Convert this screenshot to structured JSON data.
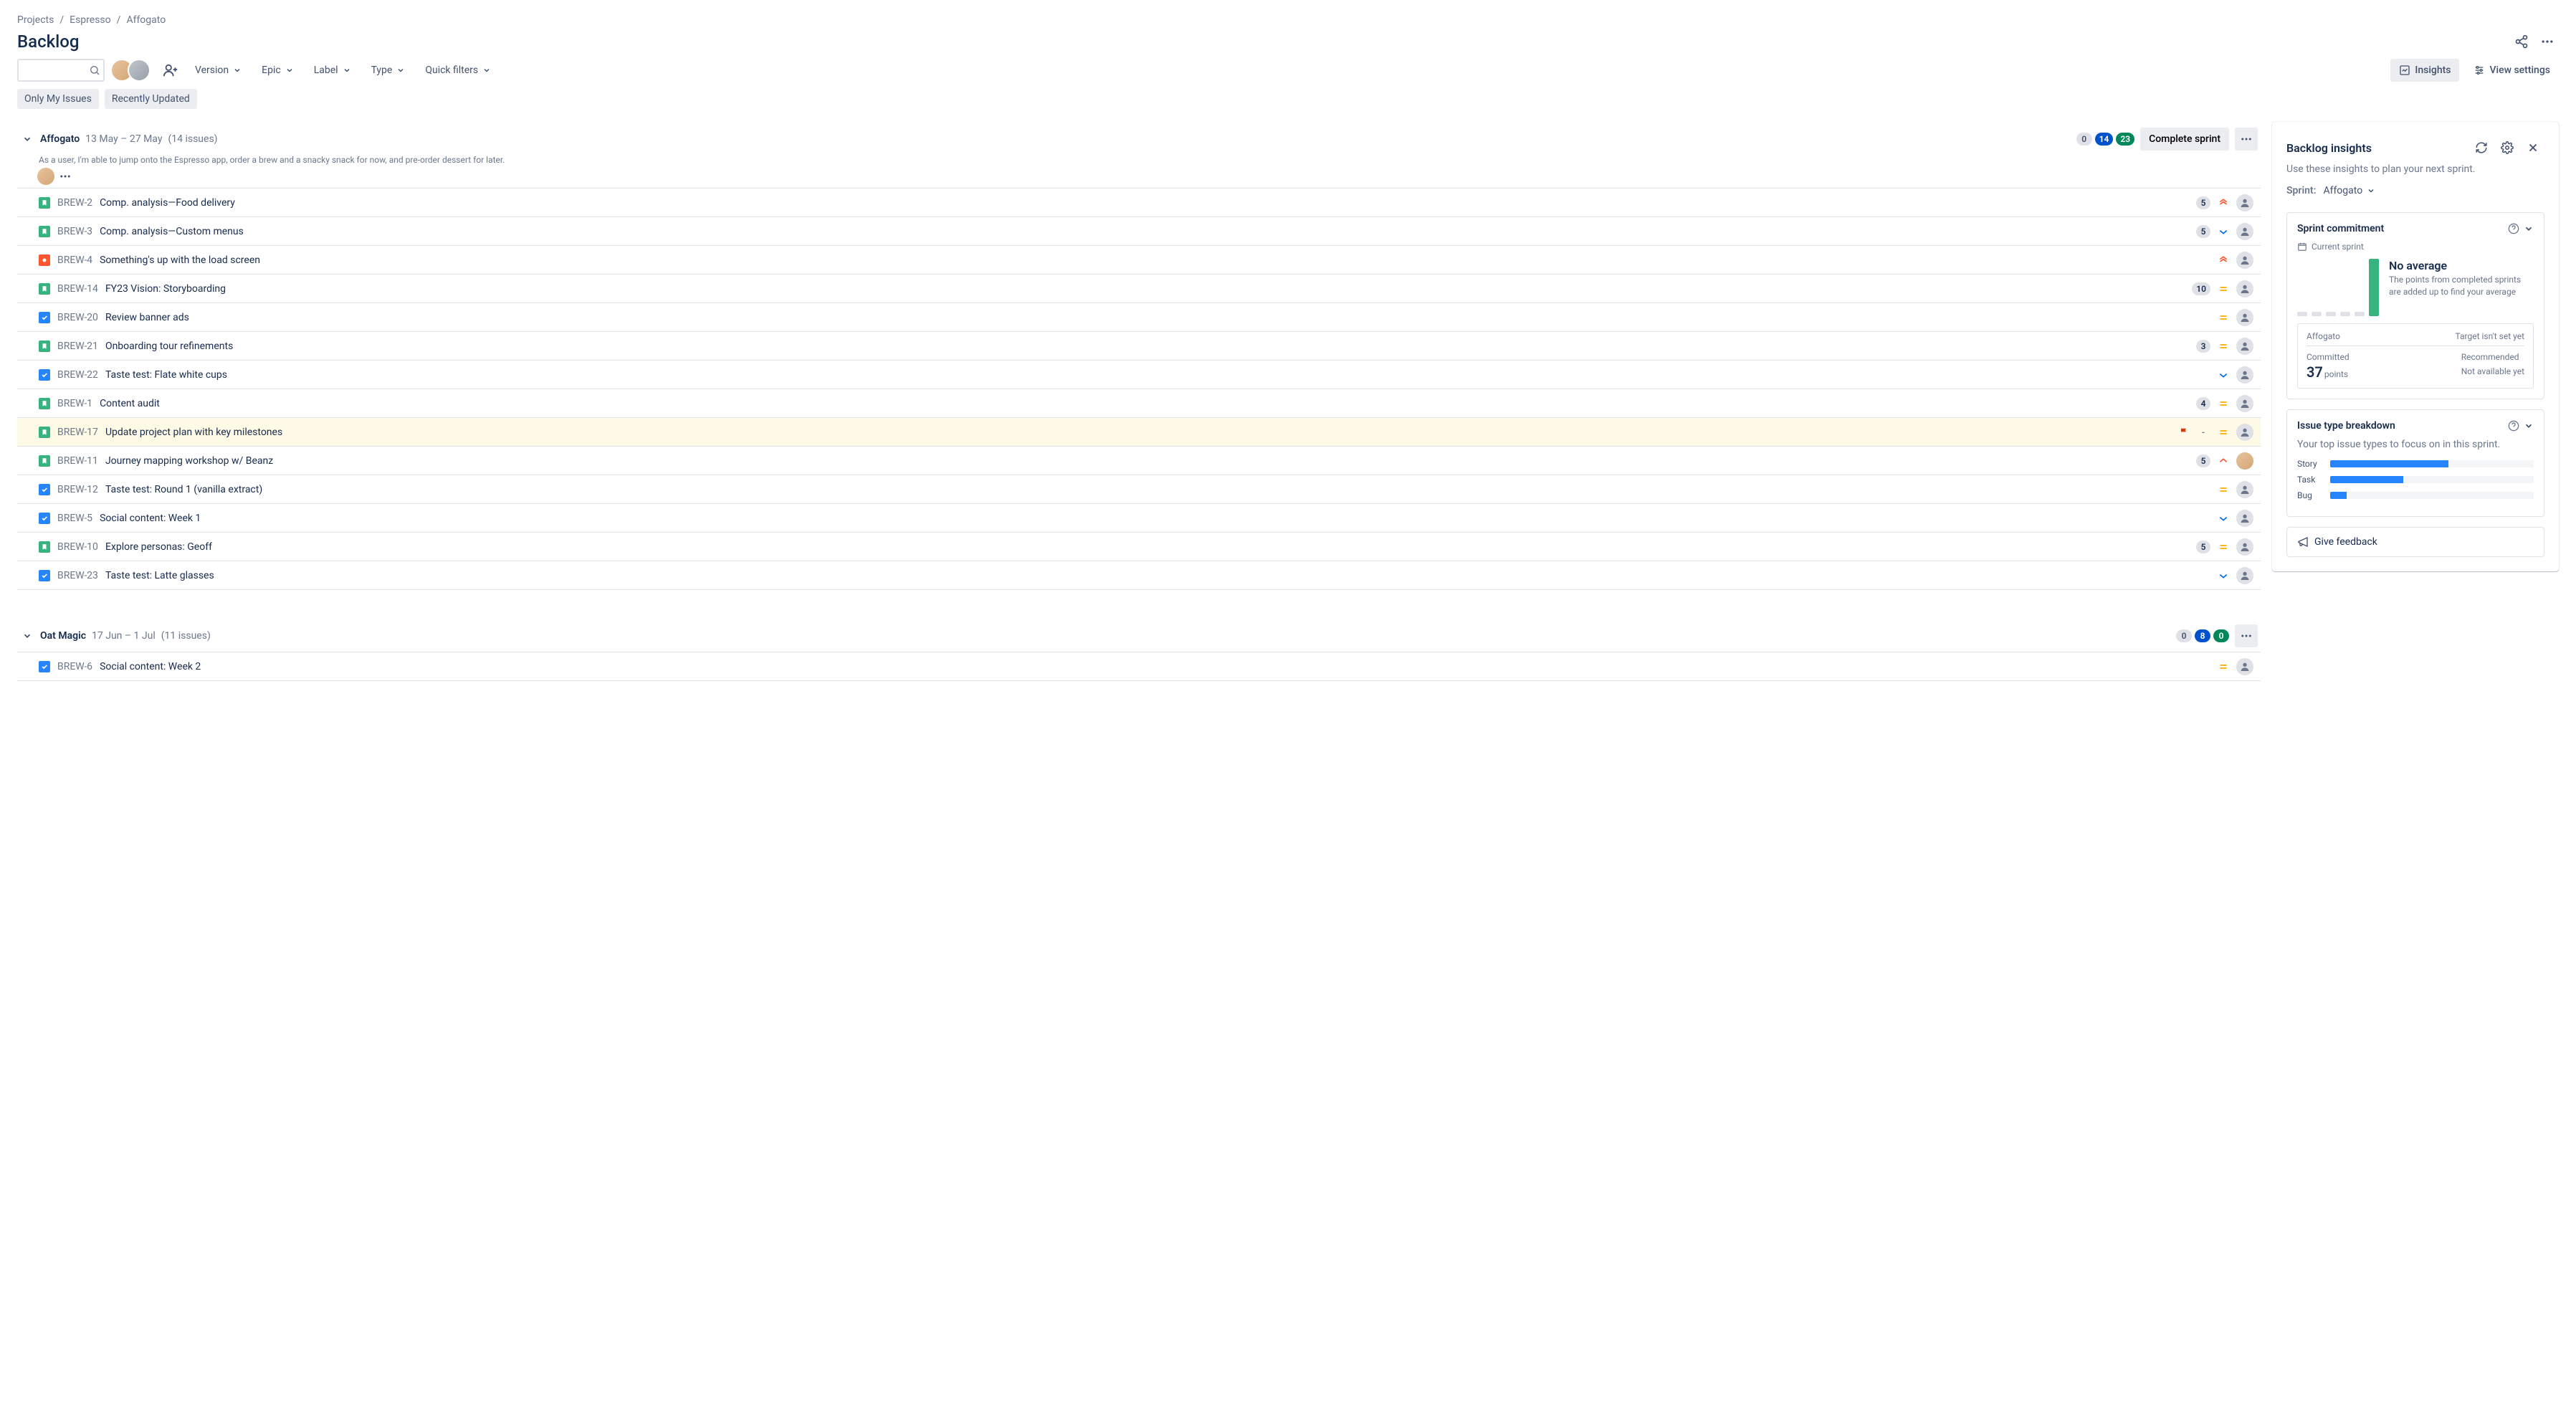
{
  "breadcrumb": {
    "items": [
      "Projects",
      "Espresso",
      "Affogato"
    ]
  },
  "page_title": "Backlog",
  "search": {
    "placeholder": ""
  },
  "toolbar": {
    "buttons": {
      "version": "Version",
      "epic": "Epic",
      "label": "Label",
      "type": "Type",
      "quick_filters": "Quick filters"
    },
    "right": {
      "insights": "Insights",
      "view_settings": "View settings"
    }
  },
  "quick_filters": {
    "only_my": "Only My Issues",
    "recent": "Recently Updated"
  },
  "sprints": [
    {
      "name": "Affogato",
      "dates": "13 May – 27 May",
      "count_text": "(14 issues)",
      "badges": {
        "gray": "0",
        "blue": "14",
        "green": "23"
      },
      "complete_label": "Complete sprint",
      "desc": "As a user, I'm able to jump onto the Espresso app, order a brew and a snacky snack for now, and pre-order dessert for later.",
      "issues": [
        {
          "type": "story",
          "key": "BREW-2",
          "summary": "Comp. analysis—Food delivery",
          "est": "5",
          "prio": "highest",
          "assignee": "unassigned"
        },
        {
          "type": "story",
          "key": "BREW-3",
          "summary": "Comp. analysis—Custom menus",
          "est": "5",
          "prio": "low",
          "assignee": "unassigned"
        },
        {
          "type": "bug",
          "key": "BREW-4",
          "summary": "Something's up with the load screen",
          "est": "",
          "prio": "highest",
          "assignee": "unassigned"
        },
        {
          "type": "story",
          "key": "BREW-14",
          "summary": "FY23 Vision: Storyboarding",
          "est": "10",
          "prio": "medium",
          "assignee": "unassigned"
        },
        {
          "type": "task",
          "key": "BREW-20",
          "summary": "Review banner ads",
          "est": "",
          "prio": "medium",
          "assignee": "unassigned"
        },
        {
          "type": "story",
          "key": "BREW-21",
          "summary": "Onboarding tour refinements",
          "est": "3",
          "prio": "medium",
          "assignee": "unassigned"
        },
        {
          "type": "task",
          "key": "BREW-22",
          "summary": "Taste test: Flate white cups",
          "est": "",
          "prio": "low",
          "assignee": "unassigned"
        },
        {
          "type": "story",
          "key": "BREW-1",
          "summary": "Content audit",
          "est": "4",
          "prio": "medium",
          "assignee": "unassigned"
        },
        {
          "type": "story",
          "key": "BREW-17",
          "summary": "Update project plan with key milestones",
          "est": "-",
          "prio": "medium",
          "assignee": "unassigned",
          "flagged": true,
          "highlighted": true
        },
        {
          "type": "story",
          "key": "BREW-11",
          "summary": "Journey mapping workshop w/ Beanz",
          "est": "5",
          "prio": "high",
          "assignee": "user"
        },
        {
          "type": "task",
          "key": "BREW-12",
          "summary": "Taste test: Round 1 (vanilla extract)",
          "est": "",
          "prio": "medium",
          "assignee": "unassigned"
        },
        {
          "type": "task",
          "key": "BREW-5",
          "summary": "Social content: Week 1",
          "est": "",
          "prio": "low",
          "assignee": "unassigned"
        },
        {
          "type": "story",
          "key": "BREW-10",
          "summary": "Explore personas: Geoff",
          "est": "5",
          "prio": "medium",
          "assignee": "unassigned"
        },
        {
          "type": "task",
          "key": "BREW-23",
          "summary": "Taste test: Latte glasses",
          "est": "",
          "prio": "low",
          "assignee": "unassigned"
        }
      ]
    },
    {
      "name": "Oat Magic",
      "dates": "17 Jun – 1 Jul",
      "count_text": "(11 issues)",
      "badges": {
        "gray": "0",
        "blue": "8",
        "green": "0"
      },
      "issues": [
        {
          "type": "task",
          "key": "BREW-6",
          "summary": "Social content: Week 2",
          "est": "",
          "prio": "medium",
          "assignee": "unassigned"
        }
      ]
    }
  ],
  "insights": {
    "title": "Backlog insights",
    "subtitle": "Use these insights to plan your next sprint.",
    "sprint_label": "Sprint:",
    "sprint_value": "Affogato",
    "commitment": {
      "title": "Sprint commitment",
      "current_sprint": "Current sprint",
      "no_avg_title": "No average",
      "no_avg_text": "The points from completed sprints are added up to find your average",
      "box_sprint": "Affogato",
      "target_text": "Target isn't set yet",
      "committed_label": "Committed",
      "committed_value": "37",
      "committed_unit": "points",
      "recommended_label": "Recommended",
      "recommended_value": "Not available yet"
    },
    "breakdown": {
      "title": "Issue type breakdown",
      "subtitle": "Your top issue types to focus on in this sprint.",
      "rows": [
        {
          "label": "Story",
          "pct": 58
        },
        {
          "label": "Task",
          "pct": 36
        },
        {
          "label": "Bug",
          "pct": 8
        }
      ]
    },
    "feedback": "Give feedback"
  }
}
